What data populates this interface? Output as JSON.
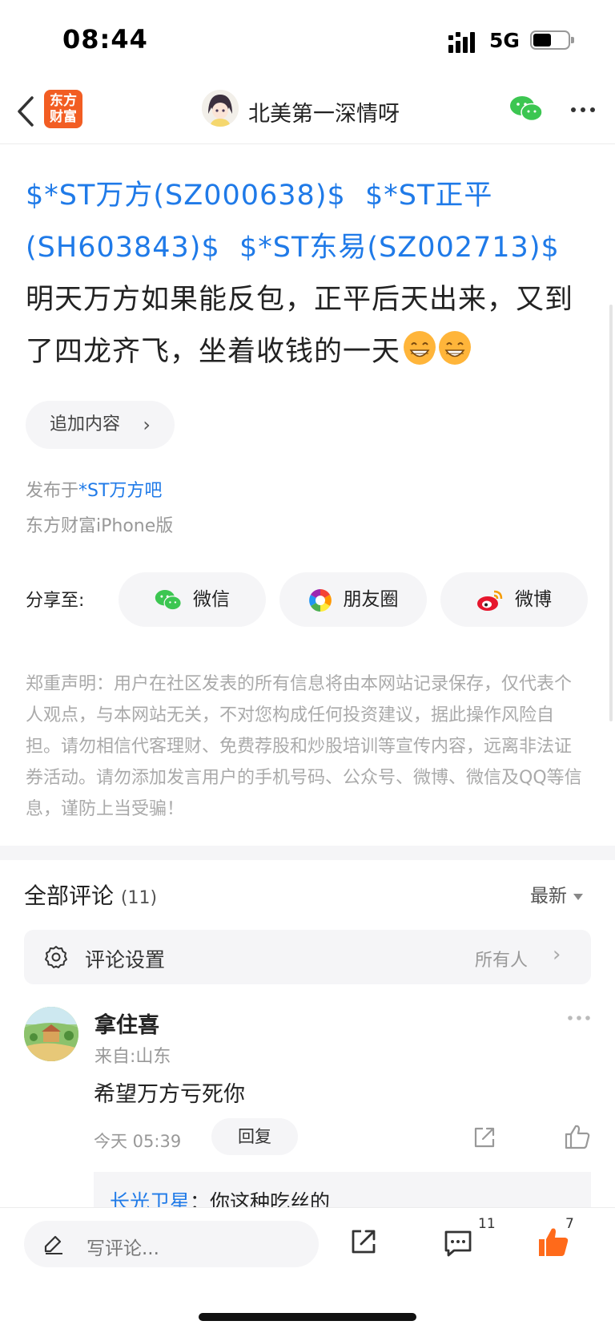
{
  "status": {
    "time": "08:44",
    "network": "5G"
  },
  "nav": {
    "logo_line1": "东方",
    "logo_line2": "财富",
    "title": "北美第一深情呀"
  },
  "post": {
    "stock1": "$*ST万方(SZ000638)$",
    "stock2": "$*ST正平(SH603843)$",
    "stock3": "$*ST东易(SZ002713)$",
    "text": "明天万方如果能反包，正平后天出来，又到了四龙齐飞，坐着收钱的一天"
  },
  "add_content_label": "追加内容",
  "posted_in": {
    "prefix": "发布于",
    "bar": "*ST万方吧"
  },
  "source": "东方财富iPhone版",
  "share": {
    "label": "分享至:",
    "wechat": "微信",
    "moments": "朋友圈",
    "weibo": "微博"
  },
  "disclaimer": "郑重声明：用户在社区发表的所有信息将由本网站记录保存，仅代表个人观点，与本网站无关，不对您构成任何投资建议，据此操作风险自担。请勿相信代客理财、免费荐股和炒股培训等宣传内容，远离非法证券活动。请勿添加发言用户的手机号码、公众号、微博、微信及QQ等信息，谨防上当受骗！",
  "comments": {
    "title": "全部评论",
    "count": "(11)",
    "sort": "最新",
    "settings_label": "评论设置",
    "settings_value": "所有人",
    "items": [
      {
        "user": "拿住喜",
        "location": "来自:山东",
        "text": "希望万方亏死你",
        "time": "今天 05:39",
        "reply_label": "回复",
        "reply_user": "长光卫星",
        "reply_text": "：你这种吃丝的"
      }
    ]
  },
  "bottom": {
    "write_placeholder": "写评论...",
    "comment_count": "11",
    "like_count": "7"
  },
  "colors": {
    "link": "#1f7ae8",
    "brand": "#f25d23",
    "like": "#ff6a1a",
    "wechat": "#3cc651"
  }
}
